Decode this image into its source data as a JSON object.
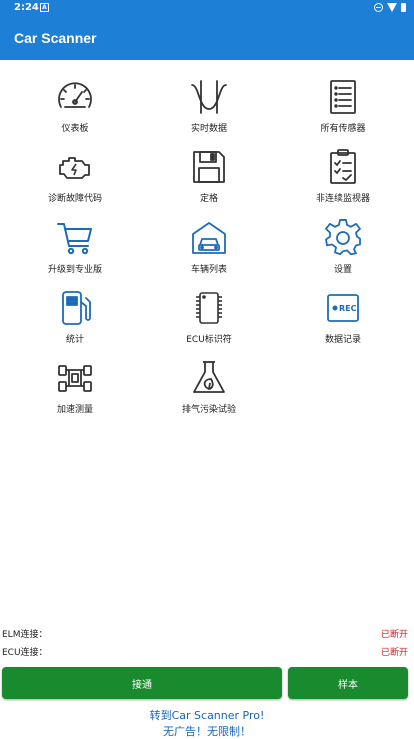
{
  "status_bar": {
    "time": "2:24",
    "notif_glyph": "A"
  },
  "app_bar": {
    "title": "Car Scanner"
  },
  "grid": [
    {
      "label": "仪表板",
      "icon": "speedometer-icon"
    },
    {
      "label": "实时数据",
      "icon": "sine-wave-icon"
    },
    {
      "label": "所有传感器",
      "icon": "list-document-icon"
    },
    {
      "label": "诊断故障代码",
      "icon": "engine-icon"
    },
    {
      "label": "定格",
      "icon": "floppy-disk-icon"
    },
    {
      "label": "非连续监视器",
      "icon": "clipboard-check-icon"
    },
    {
      "label": "升级到专业版",
      "icon": "shopping-cart-icon"
    },
    {
      "label": "车辆列表",
      "icon": "garage-car-icon"
    },
    {
      "label": "设置",
      "icon": "gear-icon"
    },
    {
      "label": "统计",
      "icon": "fuel-pump-icon"
    },
    {
      "label": "ECU标识符",
      "icon": "chip-icon"
    },
    {
      "label": "数据记录",
      "icon": "record-icon"
    },
    {
      "label": "加速测量",
      "icon": "race-car-icon"
    },
    {
      "label": "排气污染试验",
      "icon": "flask-leaf-icon"
    }
  ],
  "record_badge": "REC",
  "connection": {
    "elm_label": "ELM连接：",
    "elm_status": "已断开",
    "ecu_label": "ECU连接：",
    "ecu_status": "已断开"
  },
  "buttons": {
    "connect": "接通",
    "sample": "样本"
  },
  "promo": {
    "line1": "转到Car Scanner Pro!",
    "line2": "无广告！无限制！"
  },
  "colors": {
    "primary": "#1e7fd6",
    "button": "#198a2e",
    "status_red": "#c62828",
    "promo_blue": "#1565c0",
    "icon_dark": "#333333",
    "icon_blue": "#1e6bb8"
  }
}
